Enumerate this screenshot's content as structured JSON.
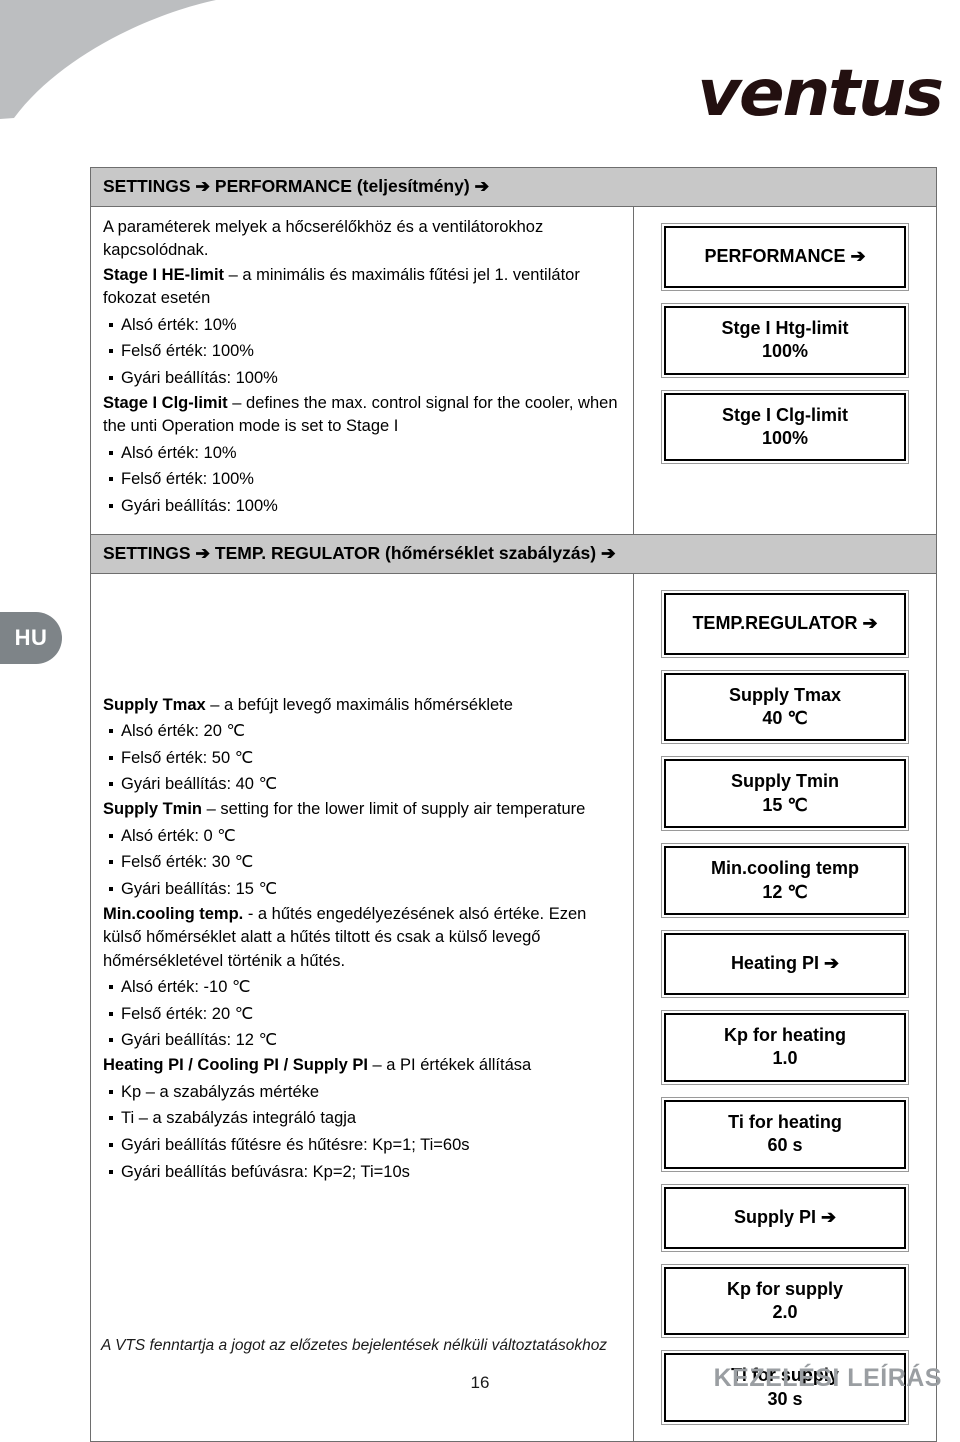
{
  "brand": {
    "logo_text": "ventus"
  },
  "language_tab": {
    "label": "HU"
  },
  "sections": [
    {
      "id": "performance",
      "header": "SETTINGS ➔ PERFORMANCE (teljesítmény) ➔",
      "paragraphs": [
        {
          "bold": "",
          "text": "A paraméterek melyek a hőcserélőkhöz és a ventilátorokhoz kapcsolódnak."
        },
        {
          "bold": "Stage I HE-limit",
          "text": " – a minimális és maximális fűtési jel 1. ventilátor fokozat esetén"
        }
      ],
      "bullets_1": [
        "Alsó érték: 10%",
        "Felső érték: 100%",
        "Gyári beállítás: 100%"
      ],
      "paragraph_2": {
        "bold": "Stage I Clg-limit",
        "text": " – defines the max. control signal for the cooler, when the unti Operation mode is set to Stage I"
      },
      "bullets_2": [
        "Alsó érték: 10%",
        "Felső érték: 100%",
        "Gyári beállítás: 100%"
      ],
      "boxes": [
        {
          "title": "PERFORMANCE ➔",
          "value": ""
        },
        {
          "title": "Stge I Htg-limit",
          "value": "100%"
        },
        {
          "title": "Stge I Clg-limit",
          "value": "100%"
        }
      ]
    },
    {
      "id": "temp-regulator",
      "header": "SETTINGS ➔ TEMP. REGULATOR (hőmérséklet szabályzás) ➔",
      "paragraph_1": {
        "bold": "Supply Tmax",
        "text": " – a befújt levegő maximális hőmérséklete"
      },
      "bullets_1": [
        "Alsó érték: 20 ℃",
        "Felső érték: 50 ℃",
        "Gyári beállítás: 40 ℃"
      ],
      "paragraph_2": {
        "bold": "Supply Tmin",
        "text": " – setting for the lower limit of supply air temperature"
      },
      "bullets_2": [
        "Alsó érték: 0 ℃",
        "Felső érték: 30 ℃",
        "Gyári beállítás: 15 ℃"
      ],
      "paragraph_3": {
        "bold": "Min.cooling temp.",
        "text": " - a hűtés engedélyezésének alsó értéke. Ezen külső hőmérséklet alatt a hűtés tiltott és csak a külső levegő hőmérsékletével történik a hűtés."
      },
      "bullets_3": [
        "Alsó érték: -10 ℃",
        "Felső érték: 20 ℃",
        "Gyári beállítás: 12 ℃"
      ],
      "paragraph_4": {
        "bold": "Heating PI / Cooling PI / Supply PI",
        "text": " – a PI értékek állítása"
      },
      "bullets_4": [
        "Kp – a szabályzás mértéke",
        "Ti – a szabályzás integráló tagja",
        "Gyári beállítás fűtésre és hűtésre: Kp=1; Ti=60s",
        "Gyári beállítás befúvásra: Kp=2; Ti=10s"
      ],
      "boxes": [
        {
          "title": "TEMP.REGULATOR ➔",
          "value": ""
        },
        {
          "title": "Supply Tmax",
          "value": "40 ℃"
        },
        {
          "title": "Supply Tmin",
          "value": "15 ℃"
        },
        {
          "title": "Min.cooling temp",
          "value": "12 ℃"
        },
        {
          "title": "Heating PI ➔",
          "value": ""
        },
        {
          "title": "Kp for heating",
          "value": "1.0"
        },
        {
          "title": "Ti for heating",
          "value": "60 s"
        },
        {
          "title": "Supply PI ➔",
          "value": ""
        },
        {
          "title": "Kp for supply",
          "value": "2.0"
        },
        {
          "title": "Ti for supply",
          "value": "30 s"
        }
      ]
    }
  ],
  "footer": {
    "note": "A VTS fenntartja a jogot az előzetes bejelentések nélküli változtatásokhoz",
    "page_number": "16",
    "doc_kind": "KEZELÉSI LEÍRÁS"
  },
  "colors": {
    "header_band": "#c8c8c8",
    "swoosh": "#bcbec0",
    "lang_tab": "#7e8488",
    "doc_kind": "#9a9ea2",
    "logo": "#231010"
  }
}
